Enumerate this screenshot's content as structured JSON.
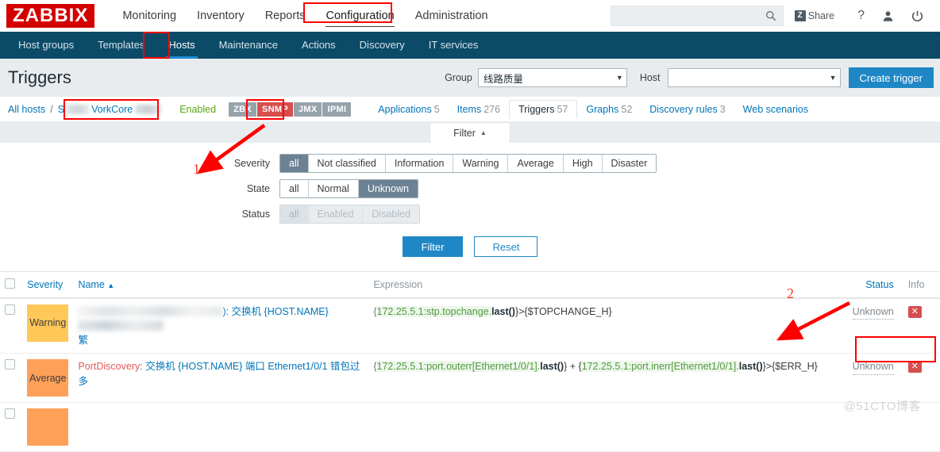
{
  "app": {
    "logo": "ZABBIX"
  },
  "topnav": {
    "items": [
      {
        "label": "Monitoring",
        "active": false
      },
      {
        "label": "Inventory",
        "active": false
      },
      {
        "label": "Reports",
        "active": false
      },
      {
        "label": "Configuration",
        "active": true
      },
      {
        "label": "Administration",
        "active": false
      }
    ],
    "search_placeholder": "",
    "share_label": "Share",
    "share_badge": "Z",
    "help_label": "?"
  },
  "subnav": {
    "items": [
      {
        "label": "Host groups",
        "active": false
      },
      {
        "label": "Templates",
        "active": false
      },
      {
        "label": "Hosts",
        "active": true
      },
      {
        "label": "Maintenance",
        "active": false
      },
      {
        "label": "Actions",
        "active": false
      },
      {
        "label": "Discovery",
        "active": false
      },
      {
        "label": "IT services",
        "active": false
      }
    ]
  },
  "pagehead": {
    "title": "Triggers",
    "group_label": "Group",
    "group_value": "线路质量",
    "host_label": "Host",
    "host_value": "",
    "create_button": "Create trigger"
  },
  "breadcrumb": {
    "all_hosts": "All hosts",
    "separator": "/",
    "host_prefix": "S",
    "host_name": "VorkCore",
    "enabled": "Enabled",
    "interfaces": [
      {
        "label": "ZBX",
        "highlighted": false
      },
      {
        "label": "SNMP",
        "highlighted": true
      },
      {
        "label": "JMX",
        "highlighted": false
      },
      {
        "label": "IPMI",
        "highlighted": false
      }
    ],
    "tabs": [
      {
        "label": "Applications",
        "count": "5",
        "active": false
      },
      {
        "label": "Items",
        "count": "276",
        "active": false
      },
      {
        "label": "Triggers",
        "count": "57",
        "active": true
      },
      {
        "label": "Graphs",
        "count": "52",
        "active": false
      },
      {
        "label": "Discovery rules",
        "count": "3",
        "active": false
      },
      {
        "label": "Web scenarios",
        "count": "",
        "active": false
      }
    ]
  },
  "filter": {
    "tab_label": "Filter",
    "tab_caret": "▲",
    "rows": [
      {
        "label": "Severity",
        "disabled": false,
        "options": [
          {
            "label": "all",
            "selected": true
          },
          {
            "label": "Not classified",
            "selected": false
          },
          {
            "label": "Information",
            "selected": false
          },
          {
            "label": "Warning",
            "selected": false
          },
          {
            "label": "Average",
            "selected": false
          },
          {
            "label": "High",
            "selected": false
          },
          {
            "label": "Disaster",
            "selected": false
          }
        ]
      },
      {
        "label": "State",
        "disabled": false,
        "options": [
          {
            "label": "all",
            "selected": false
          },
          {
            "label": "Normal",
            "selected": false
          },
          {
            "label": "Unknown",
            "selected": true
          }
        ]
      },
      {
        "label": "Status",
        "disabled": true,
        "options": [
          {
            "label": "all",
            "selected": true
          },
          {
            "label": "Enabled",
            "selected": false
          },
          {
            "label": "Disabled",
            "selected": false
          }
        ]
      }
    ],
    "apply_button": "Filter",
    "reset_button": "Reset"
  },
  "table": {
    "headers": {
      "severity": "Severity",
      "name": "Name",
      "sort_caret": "▲",
      "expression": "Expression",
      "status": "Status",
      "info": "Info"
    },
    "rows": [
      {
        "severity": "Warning",
        "severity_color": "#ffc859",
        "name_prefix": "",
        "name_mid": "): 交换机 {HOST.NAME} ",
        "name_tail": "繁",
        "expression_parts": [
          {
            "text": "{",
            "kind": "brace"
          },
          {
            "text": "172.25.5.1:stp.topchange.",
            "kind": "item"
          },
          {
            "text": "last()",
            "kind": "func"
          },
          {
            "text": "}>{$TOPCHANGE_H}",
            "kind": "plain"
          }
        ],
        "status": "Unknown",
        "info_badge": "✕"
      },
      {
        "severity": "Average",
        "severity_color": "#ffa059",
        "name_link": "PortDiscovery",
        "name_text": ": 交换机 {HOST.NAME} 端口 Ethernet1/0/1 错包过多",
        "expression_parts": [
          {
            "text": "{",
            "kind": "brace"
          },
          {
            "text": "172.25.5.1:port.outerr[Ethernet1/0/1].",
            "kind": "item"
          },
          {
            "text": "last()",
            "kind": "func"
          },
          {
            "text": "} + {",
            "kind": "plain"
          },
          {
            "text": "172.25.5.1:port.inerr[Ethernet1/0/1].",
            "kind": "item"
          },
          {
            "text": "last()",
            "kind": "func"
          },
          {
            "text": "}>{$ERR_H}",
            "kind": "plain"
          }
        ],
        "status": "Unknown",
        "info_badge": "✕"
      }
    ]
  },
  "annotations": {
    "marker_1": "1",
    "marker_2": "2",
    "color": "#ff0000"
  },
  "watermark": "@51CTO博客"
}
